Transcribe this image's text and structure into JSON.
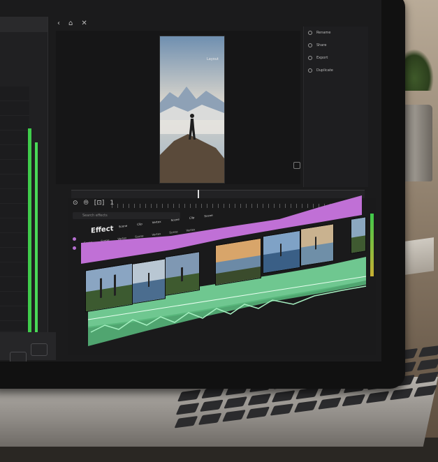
{
  "toolbar": {
    "back_icon": "‹",
    "home_icon": "⌂",
    "close_icon": "✕"
  },
  "preview": {
    "overlay_text": "Layout"
  },
  "menu": {
    "items": [
      {
        "label": "Rename"
      },
      {
        "label": "Share"
      },
      {
        "label": "Export"
      },
      {
        "label": "Duplicate"
      }
    ]
  },
  "timeline": {
    "tools": [
      "⊙",
      "⦾",
      "[⊡]",
      "1"
    ],
    "search_placeholder": "Search effects",
    "track_title": "Effect",
    "labels": [
      "Scene",
      "Scene",
      "Vertex",
      "Scene",
      "Vertex",
      "Scene",
      "Vertex"
    ],
    "labels2": [
      "Scene",
      "Clip",
      "Vertex",
      "Scene",
      "Clip",
      "Scene"
    ]
  },
  "colors": {
    "accent_purple": "#c070d6",
    "accent_green": "#6fc790",
    "meter_green": "#3fcc4b"
  }
}
